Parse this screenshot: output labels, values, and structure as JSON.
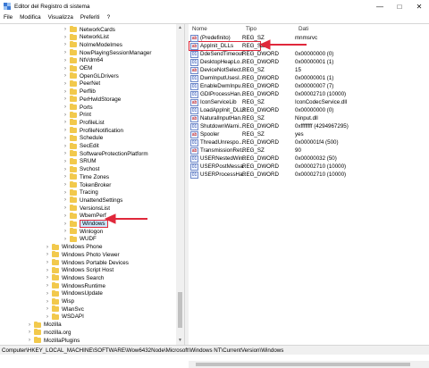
{
  "window": {
    "title": "Editor del Registro di sistema",
    "controls": {
      "minimize": "—",
      "maximize": "□",
      "close": "✕"
    }
  },
  "menu": [
    "File",
    "Modifica",
    "Visualizza",
    "Preferiti",
    "?"
  ],
  "tree": [
    {
      "label": "NetworkCards",
      "indent": 1
    },
    {
      "label": "NetworkList",
      "indent": 1
    },
    {
      "label": "NoImeModeImes",
      "indent": 1
    },
    {
      "label": "NowPlayingSessionManager",
      "indent": 1
    },
    {
      "label": "NtVdm64",
      "indent": 1
    },
    {
      "label": "OEM",
      "indent": 1
    },
    {
      "label": "OpenGLDrivers",
      "indent": 1
    },
    {
      "label": "PeerNet",
      "indent": 1
    },
    {
      "label": "Perflib",
      "indent": 1
    },
    {
      "label": "PerHwIdStorage",
      "indent": 1
    },
    {
      "label": "Ports",
      "indent": 1
    },
    {
      "label": "Print",
      "indent": 1
    },
    {
      "label": "ProfileList",
      "indent": 1
    },
    {
      "label": "ProfileNotification",
      "indent": 1
    },
    {
      "label": "Schedule",
      "indent": 1
    },
    {
      "label": "SecEdit",
      "indent": 1
    },
    {
      "label": "SoftwareProtectionPlatform",
      "indent": 1
    },
    {
      "label": "SRUM",
      "indent": 1
    },
    {
      "label": "Svchost",
      "indent": 1
    },
    {
      "label": "Time Zones",
      "indent": 1
    },
    {
      "label": "TokenBroker",
      "indent": 1
    },
    {
      "label": "Tracing",
      "indent": 1
    },
    {
      "label": "UnattendSettings",
      "indent": 1
    },
    {
      "label": "VersionsList",
      "indent": 1
    },
    {
      "label": "WbemPerf",
      "indent": 1
    },
    {
      "label": "Windows",
      "indent": 1,
      "selected": true
    },
    {
      "label": "Winlogon",
      "indent": 1
    },
    {
      "label": "WUDF",
      "indent": 1
    },
    {
      "label": "Windows Phone",
      "indent": 0
    },
    {
      "label": "Windows Photo Viewer",
      "indent": 0
    },
    {
      "label": "Windows Portable Devices",
      "indent": 0
    },
    {
      "label": "Windows Script Host",
      "indent": 0
    },
    {
      "label": "Windows Search",
      "indent": 0
    },
    {
      "label": "WindowsRuntime",
      "indent": 0
    },
    {
      "label": "WindowsUpdate",
      "indent": 0
    },
    {
      "label": "Wisp",
      "indent": 0
    },
    {
      "label": "WlanSvc",
      "indent": 0
    },
    {
      "label": "WSDAPI",
      "indent": 0
    },
    {
      "label": "Mozilla",
      "indent": -1
    },
    {
      "label": "mozilla.org",
      "indent": -1
    },
    {
      "label": "MozillaPlugins",
      "indent": -1
    },
    {
      "label": "ODBC",
      "indent": -1
    }
  ],
  "columns": {
    "name": "Nome",
    "type": "Tipo",
    "data": "Dati"
  },
  "values": [
    {
      "name": "(Predefinito)",
      "type": "REG_SZ",
      "data": "mnmsrvc",
      "kind": "sz"
    },
    {
      "name": "AppInit_DLLs",
      "type": "REG_SZ",
      "data": "",
      "kind": "sz",
      "highlighted": true
    },
    {
      "name": "DdeSendTimeout",
      "type": "REG_DWORD",
      "data": "0x00000000 (0)",
      "kind": "dw"
    },
    {
      "name": "DesktopHeapLo...",
      "type": "REG_DWORD",
      "data": "0x00000001 (1)",
      "kind": "dw"
    },
    {
      "name": "DeviceNotSelect...",
      "type": "REG_SZ",
      "data": "15",
      "kind": "sz"
    },
    {
      "name": "DwmInputUsesI...",
      "type": "REG_DWORD",
      "data": "0x00000001 (1)",
      "kind": "dw"
    },
    {
      "name": "EnableDwmInpu...",
      "type": "REG_DWORD",
      "data": "0x00000007 (7)",
      "kind": "dw"
    },
    {
      "name": "GDIProcessHan...",
      "type": "REG_DWORD",
      "data": "0x00002710 (10000)",
      "kind": "dw"
    },
    {
      "name": "IconServiceLib",
      "type": "REG_SZ",
      "data": "IconCodecService.dll",
      "kind": "sz"
    },
    {
      "name": "LoadAppInit_DLLs",
      "type": "REG_DWORD",
      "data": "0x00000000 (0)",
      "kind": "dw"
    },
    {
      "name": "NaturalInputHan...",
      "type": "REG_SZ",
      "data": "Ninput.dll",
      "kind": "sz"
    },
    {
      "name": "ShutdownWarni...",
      "type": "REG_DWORD",
      "data": "0xffffffff (4294967295)",
      "kind": "dw"
    },
    {
      "name": "Spooler",
      "type": "REG_SZ",
      "data": "yes",
      "kind": "sz"
    },
    {
      "name": "ThreadUnrespo...",
      "type": "REG_DWORD",
      "data": "0x000001f4 (500)",
      "kind": "dw"
    },
    {
      "name": "TransmissionRet...",
      "type": "REG_SZ",
      "data": "90",
      "kind": "sz"
    },
    {
      "name": "USERNestedWin...",
      "type": "REG_DWORD",
      "data": "0x00000032 (50)",
      "kind": "dw"
    },
    {
      "name": "USERPostMessa...",
      "type": "REG_DWORD",
      "data": "0x00002710 (10000)",
      "kind": "dw"
    },
    {
      "name": "USERProcessHa...",
      "type": "REG_DWORD",
      "data": "0x00002710 (10000)",
      "kind": "dw"
    }
  ],
  "status": "Computer\\HKEY_LOCAL_MACHINE\\SOFTWARE\\Wow6432Node\\Microsoft\\Windows NT\\CurrentVersion\\Windows",
  "colors": {
    "accent_red": "#e0283b",
    "folder": "#f2c94c",
    "selection": "#cce8ff"
  },
  "icons": {
    "sz_value": "ab-icon",
    "dword_value": "binary-icon",
    "folder": "folder-icon",
    "app": "regedit-icon"
  }
}
